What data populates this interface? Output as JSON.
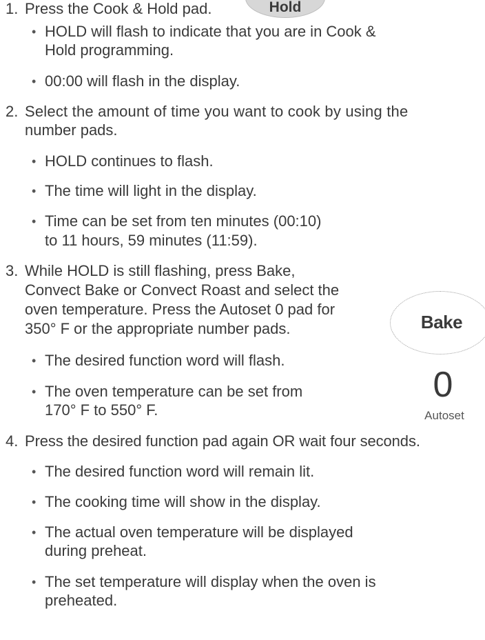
{
  "steps": [
    {
      "num": "1.",
      "lines": [
        "Press the Cook & Hold pad."
      ],
      "bullets": [
        {
          "lines": [
            "HOLD will flash to indicate that you are in Cook &",
            "Hold programming."
          ]
        },
        {
          "lines": [
            "00:00 will flash in the display."
          ]
        }
      ]
    },
    {
      "num": "2.",
      "lines": [
        "Select the amount of time you want to cook by using the",
        "number pads."
      ],
      "bullets": [
        {
          "lines": [
            "HOLD continues to flash."
          ]
        },
        {
          "lines": [
            "The time will light in the display."
          ]
        },
        {
          "lines": [
            "Time can be set from ten minutes (00:10)",
            "to 11 hours, 59 minutes (11:59)."
          ]
        }
      ]
    },
    {
      "num": "3.",
      "lines": [
        "While HOLD is still flashing, press Bake,",
        "Convect Bake or Convect Roast and select the",
        "oven temperature. Press the Autoset 0 pad for",
        "350° F or the appropriate number pads."
      ],
      "bullets": [
        {
          "lines": [
            "The desired function word will flash."
          ]
        },
        {
          "lines": [
            "The oven temperature can be set from",
            "170° F to 550° F."
          ]
        }
      ]
    },
    {
      "num": "4.",
      "lines": [
        "Press the desired function pad again OR wait four seconds."
      ],
      "bullets": [
        {
          "lines": [
            "The desired function word will remain lit."
          ]
        },
        {
          "lines": [
            "The cooking time will show in the display."
          ]
        },
        {
          "lines": [
            "The actual oven temperature will be displayed",
            "during preheat."
          ]
        },
        {
          "lines": [
            "The set temperature will display when the oven is",
            "preheated."
          ]
        }
      ]
    }
  ],
  "pads": {
    "hold_label": "Hold",
    "bake_label": "Bake",
    "autoset_digit": "0",
    "autoset_label": "Autoset"
  }
}
